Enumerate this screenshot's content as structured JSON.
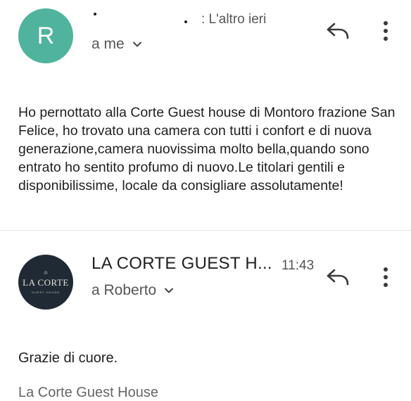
{
  "message1": {
    "avatar_letter": "R",
    "date": ": L'altro ieri",
    "recipient": "a me",
    "body": "Ho pernottato alla Corte Guest house  di Montoro frazione San Felice, ho trovato una camera con tutti i confort e di nuova generazione,camera nuovissima molto bella,quando sono entrato ho sentito profumo di nuovo.Le titolari gentili e disponibilissime, locale da consigliare assolutamente!"
  },
  "message2": {
    "avatar_logo_main": "LA CORTE",
    "avatar_logo_sub": "GUEST HOUSE",
    "sender": "LA CORTE GUEST H...",
    "time": "11:43",
    "recipient": "a Roberto",
    "body": "Grazie di cuore.",
    "signature_partial": "La Corte Guest House"
  },
  "icons": {
    "reply": "reply-icon",
    "more": "more-vert-icon",
    "expand": "chevron-down-icon"
  },
  "colors": {
    "avatar_r": "#4fb39d",
    "avatar_logo_bg": "#1f2a35",
    "text_primary": "#1f1f1f",
    "text_secondary": "#555555"
  }
}
